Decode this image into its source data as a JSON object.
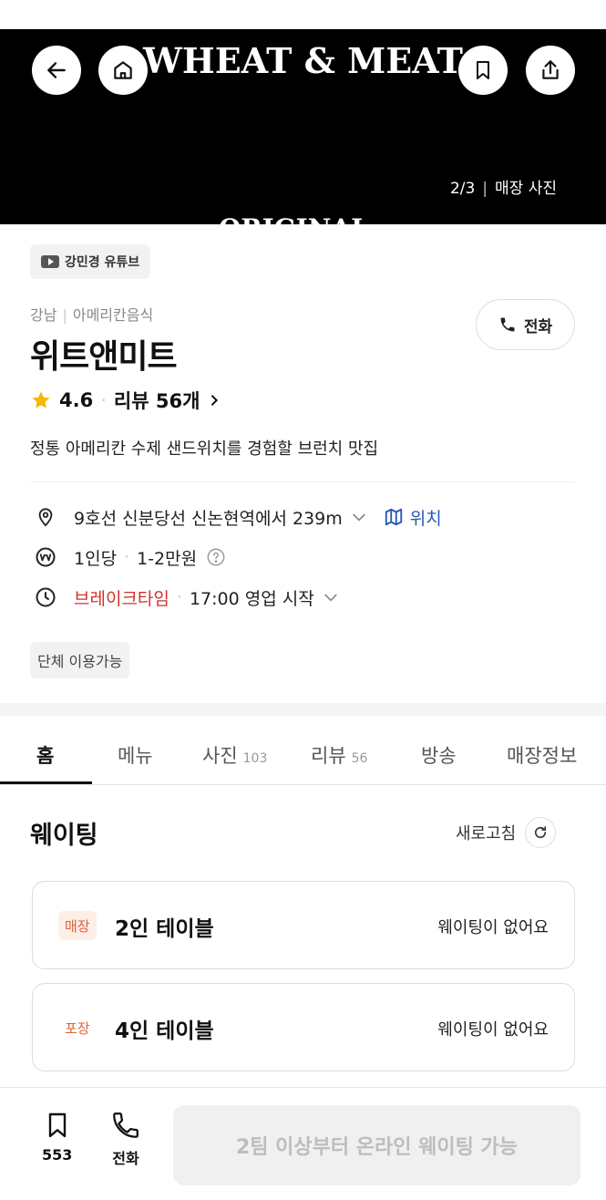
{
  "hero": {
    "logo_text": "WHEAT & MEAT",
    "sub_text": "ORIGINAL",
    "counter": "2/3",
    "counter_label": "매장 사진"
  },
  "source_chip": {
    "label": "강민경 유튜브"
  },
  "store": {
    "area": "강남",
    "category": "아메리칸음식",
    "call_label": "전화",
    "name": "위트앤미트",
    "rating": "4.6",
    "reviews_label": "리뷰 56개",
    "description": "정통 아메리칸 수제 샌드위치를 경험할 브런치 맛집"
  },
  "info": {
    "location": "9호선 신분당선 신논현역에서 239m",
    "map_label": "위치",
    "price_per": "1인당",
    "price_range": "1-2만원",
    "status": "브레이크타임",
    "hours": "17:00 영업 시작",
    "group_chip": "단체 이용가능"
  },
  "tabs": [
    {
      "label": "홈",
      "count": ""
    },
    {
      "label": "메뉴",
      "count": ""
    },
    {
      "label": "사진",
      "count": "103"
    },
    {
      "label": "리뷰",
      "count": "56"
    },
    {
      "label": "방송",
      "count": ""
    },
    {
      "label": "매장정보",
      "count": ""
    }
  ],
  "waiting": {
    "title": "웨이팅",
    "refresh_label": "새로고침",
    "cards": [
      {
        "badge": "매장",
        "table": "2인 테이블",
        "state": "웨이팅이 없어요"
      },
      {
        "badge": "포장",
        "table": "4인 테이블",
        "state": "웨이팅이 없어요"
      }
    ]
  },
  "bottom": {
    "save_count": "553",
    "call_label": "전화",
    "cta_label": "2팀 이상부터 온라인 웨이팅 가능"
  },
  "colors": {
    "accent_red": "#d0332a",
    "link_blue": "#2457b8",
    "badge_orange": "#e0633a",
    "star": "#f5b800"
  }
}
